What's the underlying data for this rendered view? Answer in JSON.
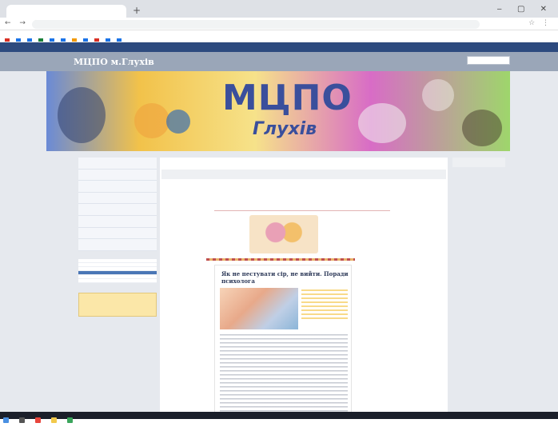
{
  "browser": {
    "url": "",
    "bookmarks": [
      "",
      "",
      "",
      "",
      "",
      "",
      "",
      "",
      "",
      "",
      ""
    ],
    "bookmark_colors": [
      "#d93025",
      "#1a73e8",
      "#1a73e8",
      "#188038",
      "#1a73e8",
      "#1a73e8",
      "#f29900",
      "#1a73e8",
      "#d93025",
      "#1a73e8",
      "#1a73e8"
    ]
  },
  "site": {
    "admin_bar_left": "",
    "admin_bar_right": "",
    "title": "МЦПО м.Глухів",
    "search_placeholder": "",
    "banner_title": "МЦПО",
    "banner_subtitle": "Глухів"
  },
  "sidebar": {
    "menu": [
      "",
      "",
      "",
      "",
      "",
      "",
      "",
      ""
    ],
    "submenu": [
      "",
      "",
      "",
      "",
      "",
      ""
    ],
    "active_index": 3,
    "widget_title": "",
    "widget_items": [
      "",
      "",
      "",
      "",
      ""
    ]
  },
  "content": {
    "breadcrumb": "",
    "post_title": "",
    "meta_date": "",
    "meta_author": "",
    "heading": "",
    "article_title": "Як не пестувати сір, не вийти. Поради психолога"
  },
  "right_column": {
    "title": ""
  },
  "colors": {
    "admin_bar": "#2d4a7e",
    "site_bar": "#9aa6b8",
    "accent": "#4a76b6",
    "banner_text": "#3a4f9c",
    "widget_bg": "#fbe7a8"
  }
}
